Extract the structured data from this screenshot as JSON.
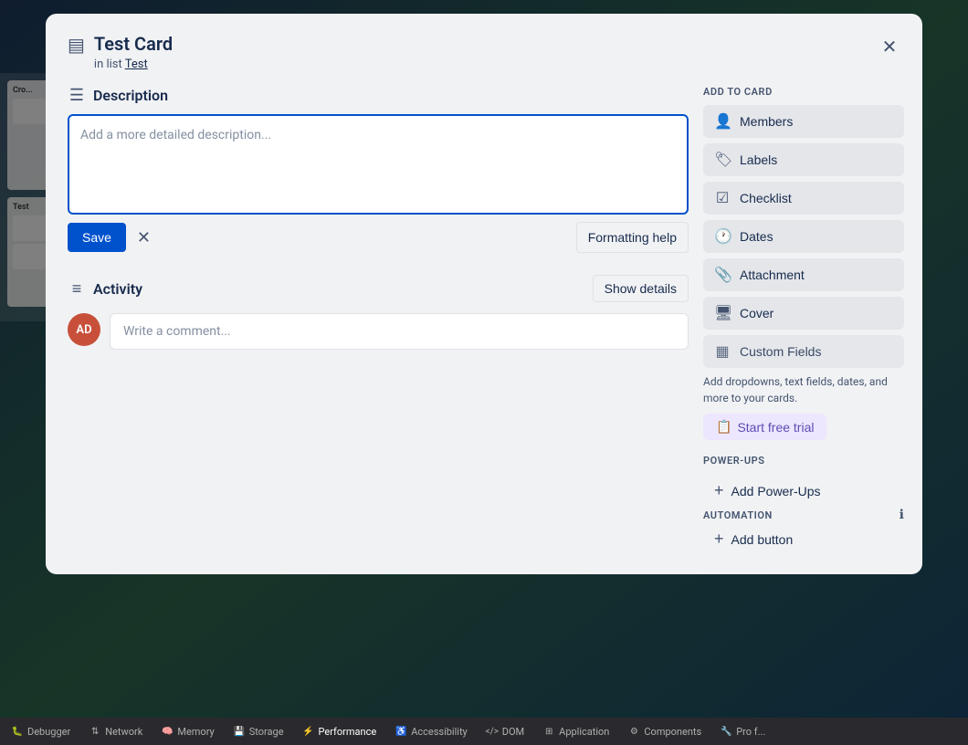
{
  "board": {
    "bg_color_start": "#1e3a5f",
    "bg_color_end": "#2d6a4f"
  },
  "modal": {
    "card_icon": "▤",
    "title": "Test Card",
    "subtitle_prefix": "in list",
    "list_name": "Test",
    "close_icon": "✕"
  },
  "description": {
    "section_icon": "☰",
    "section_title": "Description",
    "placeholder": "Add a more detailed description...",
    "save_label": "Save",
    "cancel_icon": "✕",
    "formatting_help_label": "Formatting help"
  },
  "activity": {
    "section_icon": "≡",
    "section_title": "Activity",
    "show_details_label": "Show details",
    "avatar_initials": "AD",
    "comment_placeholder": "Write a comment..."
  },
  "sidebar": {
    "add_to_card_title": "ADD TO CARD",
    "buttons": [
      {
        "icon": "👤",
        "label": "Members"
      },
      {
        "icon": "🏷",
        "label": "Labels"
      },
      {
        "icon": "☑",
        "label": "Checklist"
      },
      {
        "icon": "🕐",
        "label": "Dates"
      },
      {
        "icon": "📎",
        "label": "Attachment"
      },
      {
        "icon": "🖥",
        "label": "Cover"
      }
    ],
    "custom_fields": {
      "icon": "▦",
      "label": "Custom Fields",
      "description": "Add dropdowns, text fields, dates, and more to your cards.",
      "trial_icon": "📋",
      "trial_label": "Start free trial"
    },
    "power_ups": {
      "section_title": "POWER-UPS",
      "add_label": "Add Power-Ups"
    },
    "automation": {
      "section_title": "AUTOMATION",
      "add_label": "Add button"
    }
  },
  "devtools": {
    "tabs": [
      {
        "icon": "🐛",
        "label": "Debugger"
      },
      {
        "icon": "↑↓",
        "label": "Network"
      },
      {
        "icon": "🧠",
        "label": "Memory"
      },
      {
        "icon": "💾",
        "label": "Storage"
      },
      {
        "icon": "⚡",
        "label": "Performance"
      },
      {
        "icon": "♿",
        "label": "Accessibility"
      },
      {
        "icon": "</>",
        "label": "DOM"
      },
      {
        "icon": "⊞",
        "label": "Application"
      },
      {
        "icon": "⚙",
        "label": "Components"
      },
      {
        "icon": "Pro",
        "label": ""
      }
    ]
  }
}
